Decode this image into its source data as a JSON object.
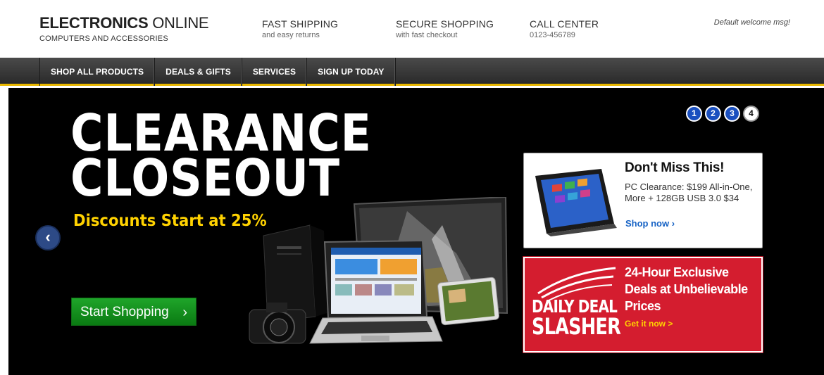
{
  "header": {
    "logo_bold": "ELECTRONICS",
    "logo_light": "ONLINE",
    "logo_sub": "COMPUTERS AND ACCESSORIES",
    "features": [
      {
        "title": "FAST SHIPPING",
        "sub": "and easy returns"
      },
      {
        "title": "SECURE SHOPPING",
        "sub": "with fast checkout"
      },
      {
        "title": "CALL CENTER",
        "sub": "0123-456789"
      }
    ],
    "welcome": "Default welcome msg!"
  },
  "nav": {
    "items": [
      "SHOP ALL PRODUCTS",
      "DEALS & GIFTS",
      "SERVICES",
      "SIGN UP TODAY"
    ]
  },
  "hero": {
    "title_line1": "CLEARANCE",
    "title_line2": "CLOSEOUT",
    "subtitle": "Discounts Start at 25%",
    "cta": "Start Shopping",
    "cta_icon": "chevron-right-icon",
    "prev_icon": "chevron-left-icon",
    "pager": [
      "1",
      "2",
      "3",
      "4"
    ],
    "pager_active": 4
  },
  "promo1": {
    "title": "Don't Miss This!",
    "text": "PC Clearance: $199 All-in-One, More + 128GB USB 3.0 $34",
    "link": "Shop now ›"
  },
  "promo2": {
    "title": "24-Hour Exclusive Deals at Unbelievable Prices",
    "link": "Get it now >",
    "badge_line1": "DAILY DEAL",
    "badge_line2": "SLASHER"
  },
  "colors": {
    "nav_accent": "#e9b800",
    "cta_green": "#1fa52a",
    "promo_red": "#d41d2f",
    "link_blue": "#1763c5",
    "subtitle_yellow": "#ffd200"
  }
}
